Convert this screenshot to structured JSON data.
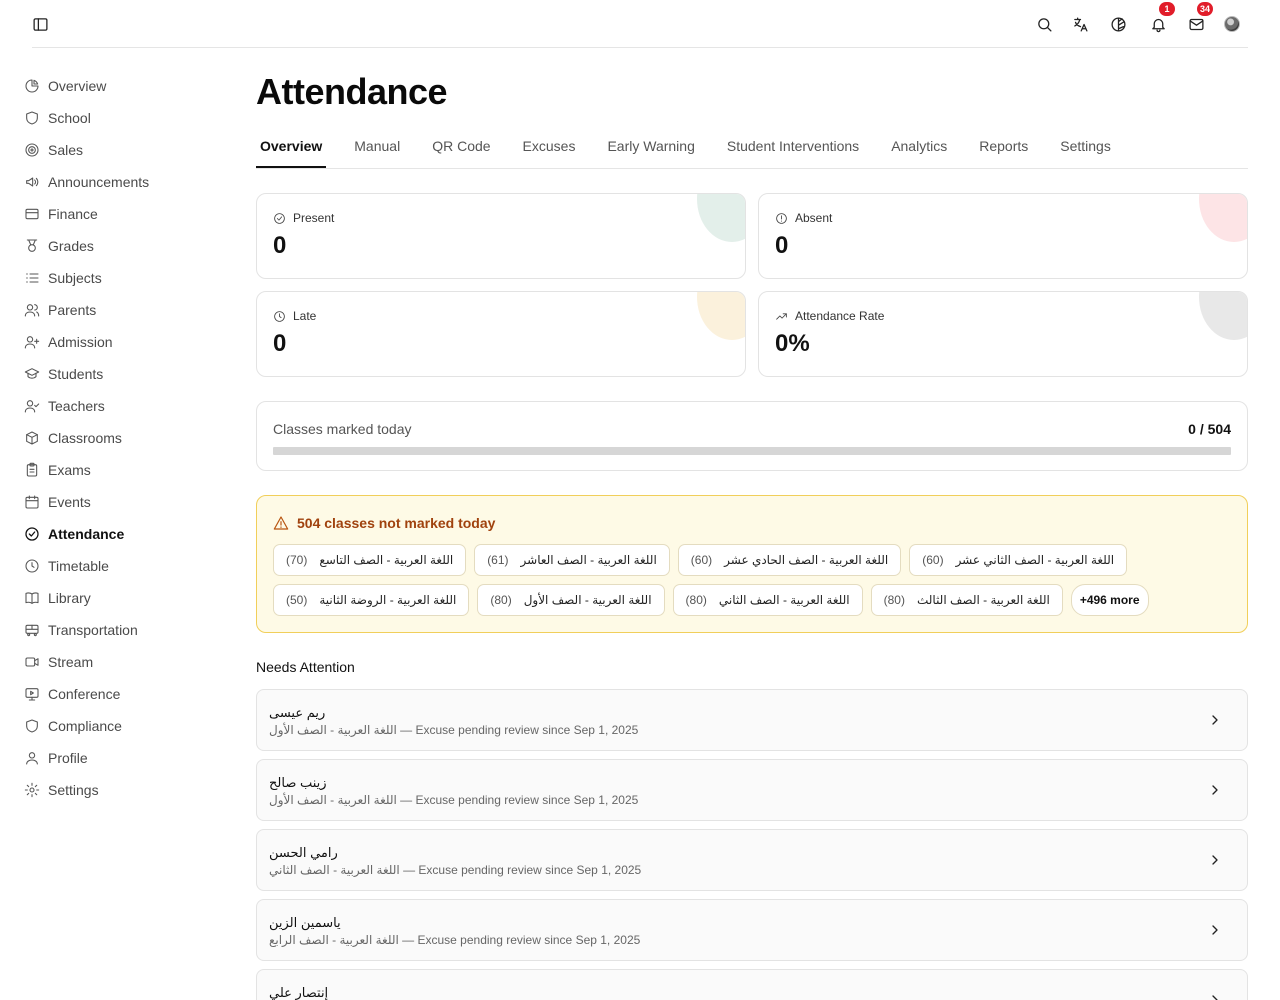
{
  "topbar": {
    "icons": [
      "sidebar-toggle-icon",
      "search-icon",
      "translate-icon",
      "theme-icon",
      "bell-icon",
      "mail-icon",
      "avatar"
    ],
    "notifications_count": "1",
    "messages_count": "34"
  },
  "sidebar": {
    "items": [
      {
        "label": "Overview",
        "icon": "pie-chart-icon"
      },
      {
        "label": "School",
        "icon": "shield-icon"
      },
      {
        "label": "Sales",
        "icon": "target-icon"
      },
      {
        "label": "Announcements",
        "icon": "megaphone-icon"
      },
      {
        "label": "Finance",
        "icon": "credit-card-icon"
      },
      {
        "label": "Grades",
        "icon": "medal-icon"
      },
      {
        "label": "Subjects",
        "icon": "list-icon"
      },
      {
        "label": "Parents",
        "icon": "users-icon"
      },
      {
        "label": "Admission",
        "icon": "user-plus-icon"
      },
      {
        "label": "Students",
        "icon": "graduation-cap-icon"
      },
      {
        "label": "Teachers",
        "icon": "user-check-icon"
      },
      {
        "label": "Classrooms",
        "icon": "box-icon"
      },
      {
        "label": "Exams",
        "icon": "clipboard-icon"
      },
      {
        "label": "Events",
        "icon": "calendar-icon"
      },
      {
        "label": "Attendance",
        "icon": "check-circle-icon",
        "active": true
      },
      {
        "label": "Timetable",
        "icon": "clock-icon"
      },
      {
        "label": "Library",
        "icon": "book-icon"
      },
      {
        "label": "Transportation",
        "icon": "bus-icon"
      },
      {
        "label": "Stream",
        "icon": "video-icon"
      },
      {
        "label": "Conference",
        "icon": "monitor-icon"
      },
      {
        "label": "Compliance",
        "icon": "shield-icon"
      },
      {
        "label": "Profile",
        "icon": "user-icon"
      },
      {
        "label": "Settings",
        "icon": "gear-icon"
      }
    ]
  },
  "page": {
    "title": "Attendance",
    "tabs": [
      "Overview",
      "Manual",
      "QR Code",
      "Excuses",
      "Early Warning",
      "Student Interventions",
      "Analytics",
      "Reports",
      "Settings"
    ],
    "active_tab": "Overview"
  },
  "stats": [
    {
      "label": "Present",
      "value": "0",
      "icon": "check-circle-icon",
      "accent": "#e3efea"
    },
    {
      "label": "Absent",
      "value": "0",
      "icon": "alert-circle-icon",
      "accent": "#fde4e6"
    },
    {
      "label": "Late",
      "value": "0",
      "icon": "clock-icon",
      "accent": "#fbf1dc"
    },
    {
      "label": "Attendance Rate",
      "value": "0%",
      "icon": "trending-up-icon",
      "accent": "#e8e8e8"
    }
  ],
  "classes_marked": {
    "label": "Classes marked today",
    "count": "0 / 504",
    "marked": 0,
    "total": 504
  },
  "warning": {
    "title": "504 classes not marked today",
    "color": "#a0420e",
    "chips": [
      {
        "name": "اللغة العربية - الصف التاسع",
        "count": "(70)"
      },
      {
        "name": "اللغة العربية - الصف العاشر",
        "count": "(61)"
      },
      {
        "name": "اللغة العربية - الصف الحادي عشر",
        "count": "(60)"
      },
      {
        "name": "اللغة العربية - الصف الثاني عشر",
        "count": "(60)"
      },
      {
        "name": "اللغة العربية - الروضة الثانية",
        "count": "(50)"
      },
      {
        "name": "اللغة العربية - الصف الأول",
        "count": "(80)"
      },
      {
        "name": "اللغة العربية - الصف الثاني",
        "count": "(80)"
      },
      {
        "name": "اللغة العربية - الصف الثالث",
        "count": "(80)"
      }
    ],
    "more": "+496 more"
  },
  "needs_attention": {
    "title": "Needs Attention",
    "items": [
      {
        "name": "ريم عيسى",
        "subject": "اللغة العربية - الصف الأول",
        "note": " — Excuse pending review since Sep 1, 2025"
      },
      {
        "name": "زينب صالح",
        "subject": "اللغة العربية - الصف الأول",
        "note": " — Excuse pending review since Sep 1, 2025"
      },
      {
        "name": "رامي الحسن",
        "subject": "اللغة العربية - الصف الثاني",
        "note": " — Excuse pending review since Sep 1, 2025"
      },
      {
        "name": "ياسمين الزين",
        "subject": "اللغة العربية - الصف الرابع",
        "note": " — Excuse pending review since Sep 1, 2025"
      },
      {
        "name": "إنتصار علي",
        "subject": "",
        "note": ""
      }
    ]
  }
}
